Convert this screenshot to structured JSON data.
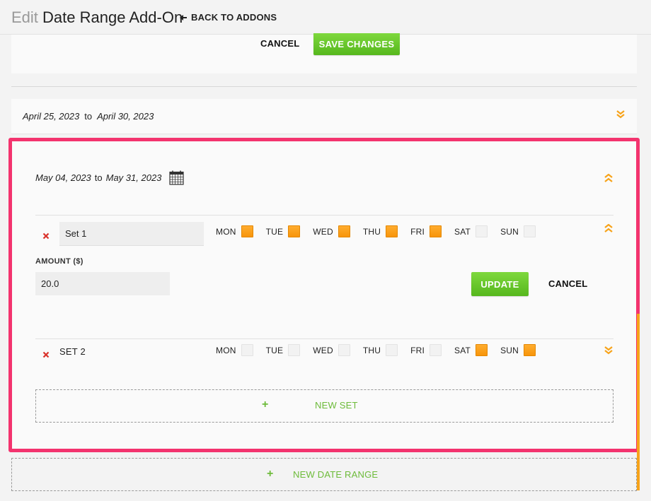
{
  "header": {
    "title_prefix": "Edit",
    "title": "Date Range Add-On",
    "back_label": "BACK TO ADDONS"
  },
  "actions": {
    "cancel_label": "CANCEL",
    "save_label": "SAVE CHANGES"
  },
  "ranges": [
    {
      "start": "April 25, 2023",
      "to": "to",
      "end": "April 30, 2023",
      "expanded": false
    },
    {
      "start": "May 04, 2023",
      "to": "to",
      "end": "May 31, 2023",
      "expanded": true,
      "sets": [
        {
          "name": "Set 1",
          "days": [
            {
              "label": "MON",
              "checked": true
            },
            {
              "label": "TUE",
              "checked": true
            },
            {
              "label": "WED",
              "checked": true
            },
            {
              "label": "THU",
              "checked": true
            },
            {
              "label": "FRI",
              "checked": true
            },
            {
              "label": "SAT",
              "checked": false
            },
            {
              "label": "SUN",
              "checked": false
            }
          ],
          "amount_label": "AMOUNT ($)",
          "amount_value": "20.0",
          "update_label": "UPDATE",
          "cancel_label": "CANCEL"
        },
        {
          "name": "SET 2",
          "days": [
            {
              "label": "MON",
              "checked": false
            },
            {
              "label": "TUE",
              "checked": false
            },
            {
              "label": "WED",
              "checked": false
            },
            {
              "label": "THU",
              "checked": false
            },
            {
              "label": "FRI",
              "checked": false
            },
            {
              "label": "SAT",
              "checked": true
            },
            {
              "label": "SUN",
              "checked": true
            }
          ]
        }
      ],
      "new_set_label": "NEW SET"
    }
  ],
  "new_range_label": "NEW DATE RANGE",
  "colors": {
    "accent_green": "#6dbb3a",
    "button_green": "#56b71d",
    "accent_orange": "#f7950a",
    "highlight_pink": "#f3336e",
    "delete_red": "#d9322b"
  },
  "icons": {
    "back": "arrow-left-icon",
    "collapse": "double-chevron-up-icon",
    "expand": "double-chevron-down-icon",
    "calendar": "calendar-icon",
    "delete": "close-x-icon",
    "add": "plus-icon"
  }
}
